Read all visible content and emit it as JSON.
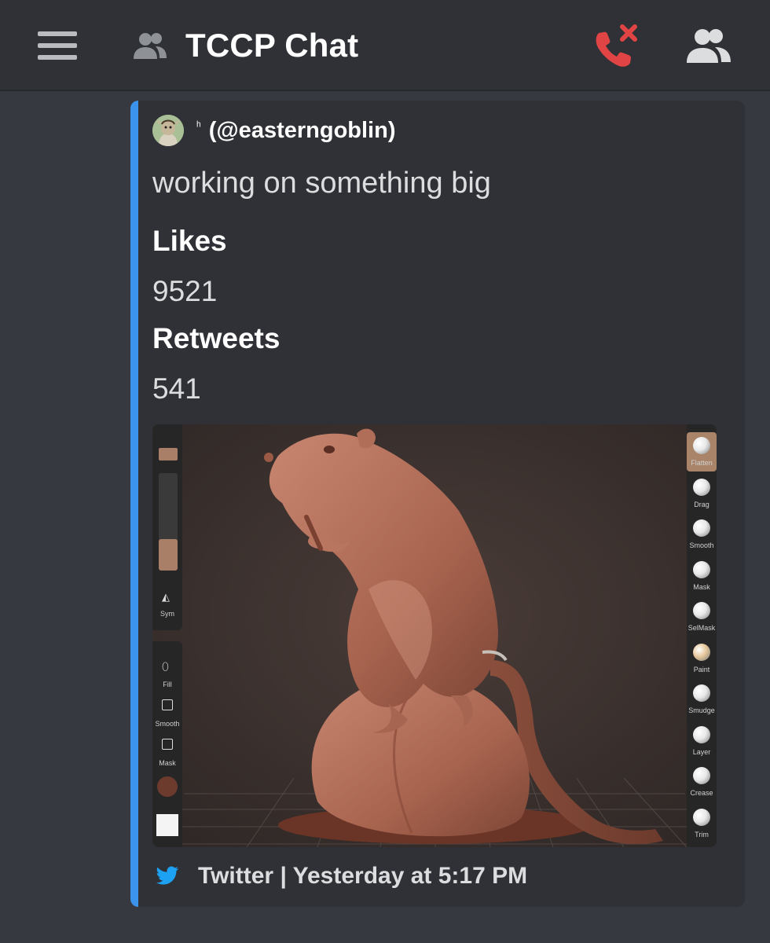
{
  "header": {
    "title": "TCCP Chat",
    "icons": [
      "menu-icon",
      "people-icon",
      "call-declined-icon",
      "members-icon"
    ],
    "colors": {
      "background": "#2f3136",
      "call_declined": "#e04444"
    }
  },
  "embed": {
    "author_prefix": "ʰ",
    "author_handle": "(@easterngoblin)",
    "description": "working on something big",
    "fields": [
      {
        "name": "Likes",
        "value": "9521"
      },
      {
        "name": "Retweets",
        "value": "541"
      }
    ],
    "image": {
      "left_toolbar": {
        "sym_label": "Sym",
        "tools": [
          "Fill",
          "Smooth",
          "Mask"
        ]
      },
      "right_toolbar": {
        "tools": [
          "Flatten",
          "Drag",
          "Smooth",
          "Mask",
          "SelMask",
          "Paint",
          "Smudge",
          "Layer",
          "Crease",
          "Trim"
        ],
        "active": "Flatten"
      }
    },
    "footer": {
      "text": "Twitter | Yesterday at 5:17 PM"
    },
    "colors": {
      "accent_bar": "#3b93ed",
      "twitter_blue": "#1da1f2"
    }
  }
}
